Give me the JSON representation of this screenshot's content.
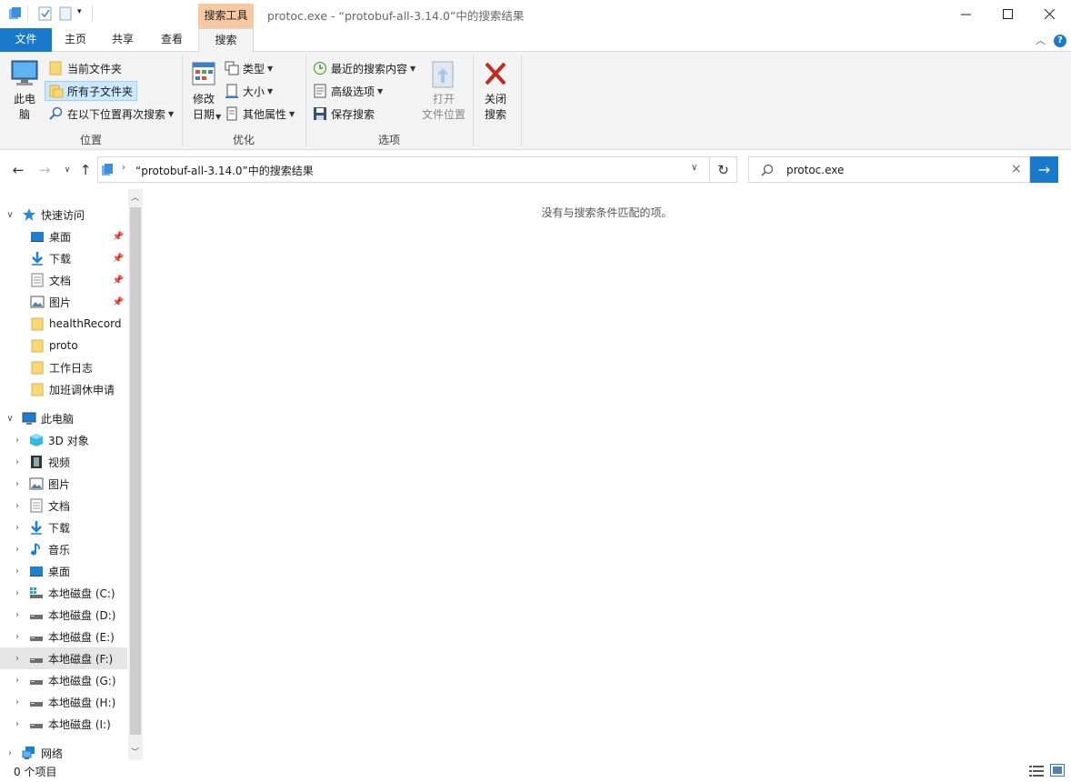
{
  "window": {
    "title": "protoc.exe - “protobuf-all-3.14.0”中的搜索结果",
    "context_tab_header": "搜索工具",
    "controls": [
      "minimize",
      "maximize",
      "close"
    ]
  },
  "ribbon": {
    "tabs": [
      "文件",
      "主页",
      "共享",
      "查看",
      "搜索"
    ],
    "active_tab": "搜索",
    "groups": {
      "location": {
        "label": "位置",
        "this_pc": "此电\n脑",
        "current_folder": "当前文件夹",
        "all_subfolders": "所有子文件夹",
        "search_again_in": "在以下位置再次搜索"
      },
      "refine": {
        "label": "优化",
        "date_modified": "修改\n日期",
        "kind": "类型",
        "size": "大小",
        "other_properties": "其他属性"
      },
      "options": {
        "label": "选项",
        "recent_searches": "最近的搜索内容",
        "advanced_options": "高级选项",
        "save_search": "保存搜索",
        "open_file_location": "打开\n文件位置",
        "close_search": "关闭\n搜索"
      }
    }
  },
  "navbar": {
    "breadcrumb": "“protobuf-all-3.14.0”中的搜索结果",
    "search_query": "protoc.exe"
  },
  "nav_pane": {
    "quick_access": {
      "label": "快速访问",
      "items": [
        {
          "label": "桌面",
          "icon": "desktop-icon",
          "pinned": true
        },
        {
          "label": "下载",
          "icon": "download-icon",
          "pinned": true
        },
        {
          "label": "文档",
          "icon": "document-icon",
          "pinned": true
        },
        {
          "label": "图片",
          "icon": "pictures-icon",
          "pinned": true
        },
        {
          "label": "healthRecord",
          "icon": "folder-icon",
          "pinned": false
        },
        {
          "label": "proto",
          "icon": "folder-icon",
          "pinned": false
        },
        {
          "label": "工作日志",
          "icon": "folder-icon",
          "pinned": false
        },
        {
          "label": "加班调休申请",
          "icon": "folder-icon",
          "pinned": false
        }
      ]
    },
    "this_pc": {
      "label": "此电脑",
      "items": [
        {
          "label": "3D 对象",
          "icon": "3d-objects-icon"
        },
        {
          "label": "视频",
          "icon": "videos-icon"
        },
        {
          "label": "图片",
          "icon": "pictures-icon"
        },
        {
          "label": "文档",
          "icon": "document-icon"
        },
        {
          "label": "下载",
          "icon": "download-icon"
        },
        {
          "label": "音乐",
          "icon": "music-icon"
        },
        {
          "label": "桌面",
          "icon": "desktop-icon"
        },
        {
          "label": "本地磁盘 (C:)",
          "icon": "system-drive-icon"
        },
        {
          "label": "本地磁盘 (D:)",
          "icon": "drive-icon"
        },
        {
          "label": "本地磁盘 (E:)",
          "icon": "drive-icon"
        },
        {
          "label": "本地磁盘 (F:)",
          "icon": "drive-icon",
          "selected": true
        },
        {
          "label": "本地磁盘 (G:)",
          "icon": "drive-icon"
        },
        {
          "label": "本地磁盘 (H:)",
          "icon": "drive-icon"
        },
        {
          "label": "本地磁盘 (I:)",
          "icon": "drive-icon"
        }
      ]
    },
    "network": {
      "label": "网络"
    }
  },
  "content": {
    "empty_message": "没有与搜索条件匹配的项。"
  },
  "status": {
    "item_count": "0 个项目"
  },
  "colors": {
    "accent": "#1979ca",
    "context_tab": "#f7c9a3",
    "selected_bg": "#cce8ff",
    "folder": "#f8d775"
  }
}
